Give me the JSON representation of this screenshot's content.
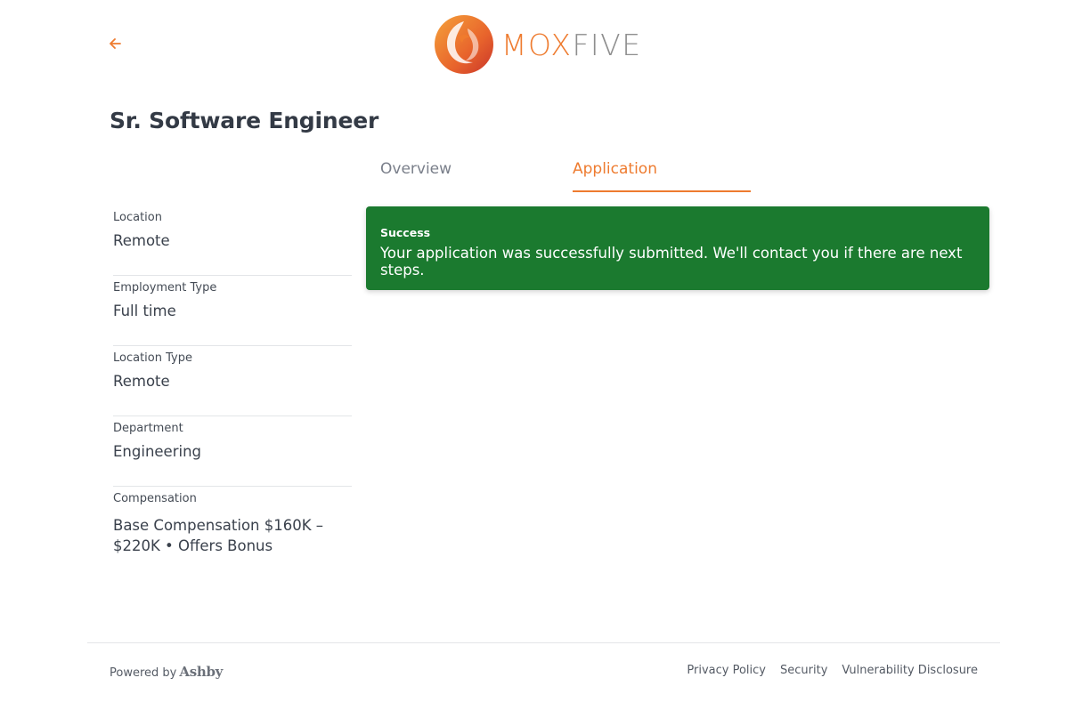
{
  "header": {
    "back_icon": "arrow-left-icon",
    "logo": {
      "text_part1": "MOX",
      "text_part2": "FIVE",
      "accent_color": "#ee7b2f",
      "secondary_color": "#8e8e8e"
    }
  },
  "job": {
    "title": "Sr. Software Engineer"
  },
  "tabs": [
    {
      "label": "Overview",
      "active": false
    },
    {
      "label": "Application",
      "active": true
    }
  ],
  "sidebar": {
    "fields": [
      {
        "label": "Location",
        "value": "Remote"
      },
      {
        "label": "Employment Type",
        "value": "Full time"
      },
      {
        "label": "Location Type",
        "value": "Remote"
      },
      {
        "label": "Department",
        "value": "Engineering"
      },
      {
        "label": "Compensation",
        "value": "Base Compensation $160K – $220K • Offers Bonus"
      }
    ]
  },
  "alert": {
    "title": "Success",
    "message": "Your application was successfully submitted. We'll contact you if there are next steps.",
    "color": "#1b7a2f"
  },
  "footer": {
    "powered_by": "Powered by",
    "brand": "Ashby",
    "links": [
      "Privacy Policy",
      "Security",
      "Vulnerability Disclosure"
    ]
  }
}
